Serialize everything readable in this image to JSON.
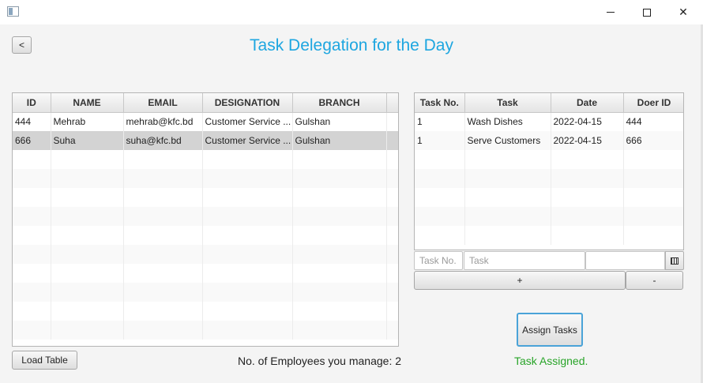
{
  "window": {
    "controls": {
      "minimize": "minimize-icon",
      "maximize": "maximize-icon",
      "close": "✕"
    }
  },
  "header": {
    "back_label": "<",
    "title": "Task Delegation for the Day"
  },
  "employees": {
    "columns": [
      "ID",
      "NAME",
      "EMAIL",
      "DESIGNATION",
      "BRANCH"
    ],
    "rows": [
      {
        "id": "444",
        "name": "Mehrab",
        "email": "mehrab@kfc.bd",
        "designation": "Customer Service ...",
        "branch": "Gulshan"
      },
      {
        "id": "666",
        "name": "Suha",
        "email": "suha@kfc.bd",
        "designation": "Customer Service ...",
        "branch": "Gulshan"
      }
    ],
    "selected_row": 1
  },
  "tasks": {
    "columns": [
      "Task No.",
      "Task",
      "Date",
      "Doer ID"
    ],
    "rows": [
      {
        "no": "1",
        "task": "Wash Dishes",
        "date": "2022-04-15",
        "doer": "444"
      },
      {
        "no": "1",
        "task": "Serve Customers",
        "date": "2022-04-15",
        "doer": "666"
      }
    ]
  },
  "task_form": {
    "task_no_placeholder": "Task No.",
    "task_placeholder": "Task",
    "date_value": "",
    "add_label": "+",
    "remove_label": "-"
  },
  "actions": {
    "assign_label": "Assign Tasks",
    "load_label": "Load Table"
  },
  "footer": {
    "employee_count_text": "No. of Employees you manage: 2",
    "status_text": "Task Assigned.",
    "status_color": "#28a428"
  },
  "colors": {
    "title": "#1ea6e0",
    "selection": "#d3d3d3",
    "focus_border": "#4aa3d8"
  }
}
